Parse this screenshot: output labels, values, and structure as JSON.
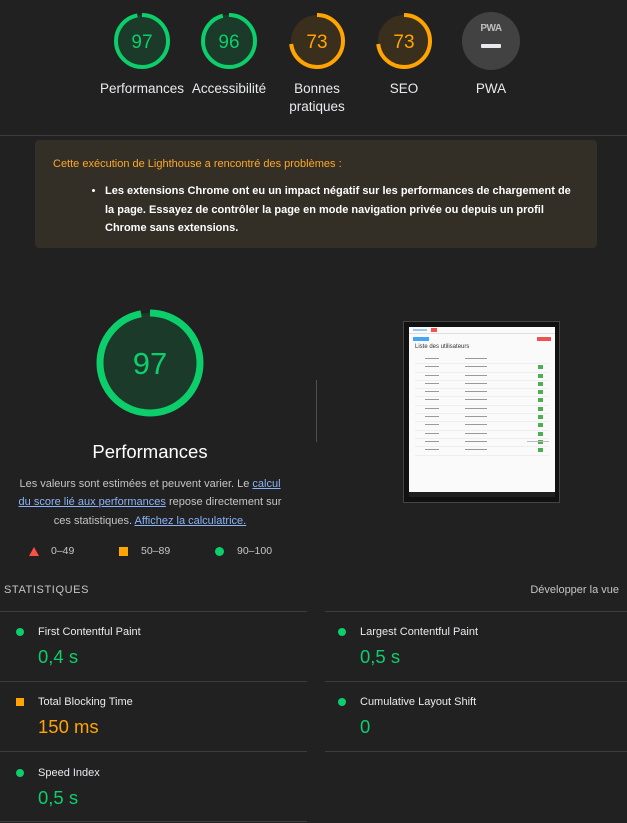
{
  "categories": [
    {
      "score": "97",
      "label": "Performances",
      "fraction": 0.97,
      "color": "#0cce6b"
    },
    {
      "score": "96",
      "label": "Accessibilité",
      "fraction": 0.96,
      "color": "#0cce6b"
    },
    {
      "score": "73",
      "label": "Bonnes pratiques",
      "fraction": 0.73,
      "color": "#ffa400"
    },
    {
      "score": "73",
      "label": "SEO",
      "fraction": 0.73,
      "color": "#ffa400"
    },
    {
      "score": "",
      "label": "PWA",
      "logo": "PWA"
    }
  ],
  "warning": {
    "title": "Cette exécution de Lighthouse a rencontré des problèmes :",
    "item": "Les extensions Chrome ont eu un impact négatif sur les performances de chargement de la page. Essayez de contrôler la page en mode navigation privée ou depuis un profil Chrome sans extensions.",
    "color": "#ffa726"
  },
  "performance": {
    "score": "97",
    "fraction": 0.97,
    "title": "Performances",
    "desc_1": "Les valeurs sont estimées et peuvent varier. Le ",
    "link_1": "calcul du score lié aux performances",
    "desc_2": " repose directement sur ces statistiques. ",
    "link_2": "Affichez la calculatrice."
  },
  "legend": [
    {
      "range": "0–49",
      "icon": "triangle-icon",
      "color": "#ff4e42"
    },
    {
      "range": "50–89",
      "icon": "square-icon",
      "color": "#ffa400"
    },
    {
      "range": "90–100",
      "icon": "circle-icon",
      "color": "#0cce6b"
    }
  ],
  "screenshot": {
    "title": "Liste des utilisateurs"
  },
  "stats": {
    "heading": "STATISTIQUES",
    "expand": "Développer la vue",
    "metrics": [
      {
        "name": "First Contentful Paint",
        "value": "0,4 s",
        "status": "pass"
      },
      {
        "name": "Largest Contentful Paint",
        "value": "0,5 s",
        "status": "pass"
      },
      {
        "name": "Total Blocking Time",
        "value": "150 ms",
        "status": "average"
      },
      {
        "name": "Cumulative Layout Shift",
        "value": "0",
        "status": "pass"
      },
      {
        "name": "Speed Index",
        "value": "0,5 s",
        "status": "pass"
      }
    ]
  }
}
